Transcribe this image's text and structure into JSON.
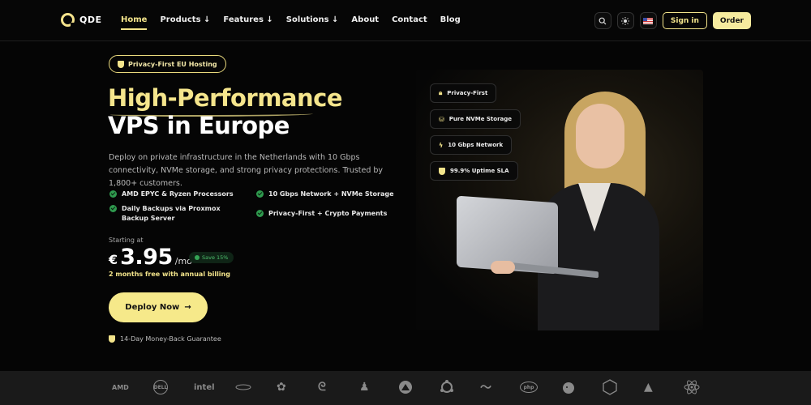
{
  "nav": {
    "logo_text": "QDE",
    "items": [
      {
        "label": "Home"
      },
      {
        "label": "Products ↓"
      },
      {
        "label": "Features ↓"
      },
      {
        "label": "Solutions ↓"
      },
      {
        "label": "About"
      },
      {
        "label": "Contact"
      },
      {
        "label": "Blog"
      }
    ],
    "signin_label": "Sign in",
    "order_label": "Order"
  },
  "hero": {
    "pill_label": "Privacy-First EU Hosting",
    "title_line1": "High-Performance",
    "title_line2": "VPS in Europe",
    "lead": "Deploy on private infrastructure in the Netherlands with 10 Gbps connectivity, NVMe storage, and strong privacy protections. Trusted by 1,800+ customers.",
    "features": [
      "AMD EPYC & Ryzen Processors",
      "10 Gbps Network + NVMe Storage",
      "Daily Backups via Proxmox Backup Server",
      "Privacy-First + Crypto Payments"
    ],
    "starting_label": "Starting at",
    "currency": "€",
    "price": "3.95",
    "period": "/mo",
    "save_label": "Save 15%",
    "promo": "2 months free with annual billing",
    "cta_label": "Deploy Now",
    "cta_arrow": "→",
    "guarantee": "14-Day Money-Back Guarantee"
  },
  "badges": [
    {
      "label": "Privacy-First",
      "icon": "lock-icon"
    },
    {
      "label": "Pure NVMe Storage",
      "icon": "database-icon"
    },
    {
      "label": "10 Gbps Network",
      "icon": "bolt-icon"
    },
    {
      "label": "99.9% Uptime SLA",
      "icon": "shield-icon"
    }
  ],
  "tech_logos": {
    "amd": "AMD",
    "dell": "DELL",
    "intel": "intel",
    "debian": "debian-icon",
    "linux": "linux-icon",
    "php": "php",
    "js": "JS"
  },
  "colors": {
    "accent": "#f5e58c",
    "background": "#050505",
    "success": "#2f9a4e"
  }
}
